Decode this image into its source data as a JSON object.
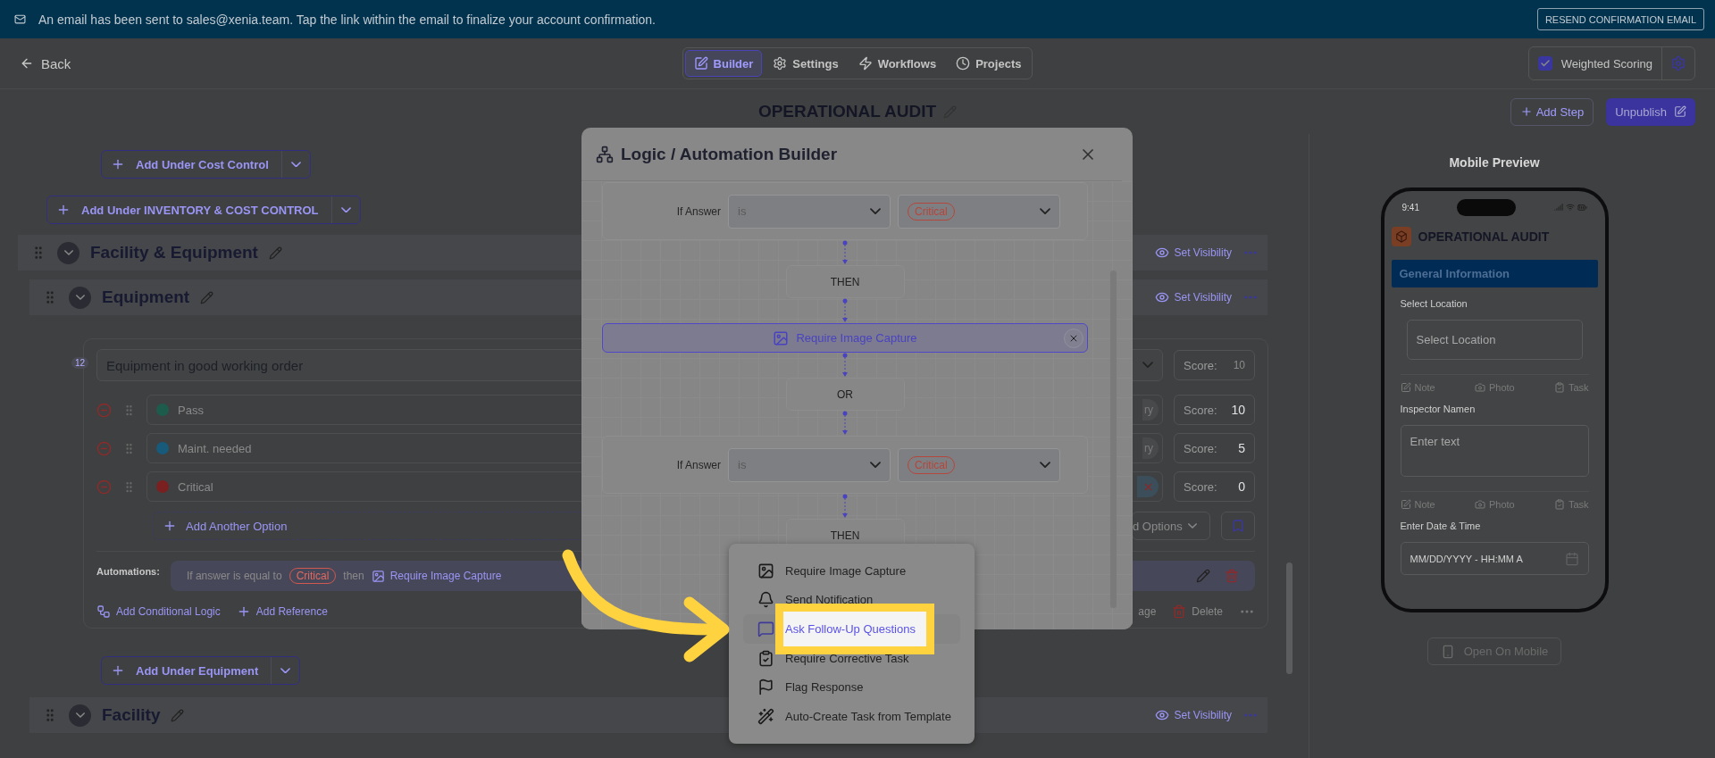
{
  "banner": {
    "message": "An email has been sent to sales@xenia.team. Tap the link within the email to finalize your account confirmation.",
    "button": "RESEND CONFIRMATION EMAIL"
  },
  "nav": {
    "back": "Back",
    "tabs": [
      {
        "label": "Builder",
        "selected": true
      },
      {
        "label": "Settings",
        "selected": false
      },
      {
        "label": "Workflows",
        "selected": false
      },
      {
        "label": "Projects",
        "selected": false
      }
    ],
    "weighted_scoring": {
      "label": "Weighted Scoring",
      "checked": true
    }
  },
  "header": {
    "title": "OPERATIONAL AUDIT",
    "add_step": "Add Step",
    "unpublish": "Unpublish"
  },
  "builder": {
    "add_cost_control": "Add Under Cost Control",
    "add_inventory": "Add Under INVENTORY & COST CONTROL",
    "section": {
      "title": "Facility & Equipment",
      "visibility": "Set Visibility"
    },
    "subsection": {
      "title": "Equipment",
      "visibility": "Set Visibility"
    },
    "question": {
      "number": "12",
      "text": "Equipment in good working order",
      "score_label": "Score:",
      "score_placeholder": "10",
      "options": [
        {
          "label": "Pass",
          "color": "#1d5c4c",
          "chip": {
            "kind": "text",
            "label": "ry"
          },
          "score_label": "Score:",
          "score": "10"
        },
        {
          "label": "Maint. needed",
          "color": "#175a7a",
          "chip": {
            "kind": "text",
            "label": "ry"
          },
          "score_label": "Score:",
          "score": "5"
        },
        {
          "label": "Critical",
          "color": "#7a2020",
          "chip": {
            "kind": "remove"
          },
          "score_label": "Score:",
          "score": "0"
        }
      ],
      "add_option": "Add Another Option",
      "options_select": "d Options",
      "automations": {
        "label": "Automations:",
        "prefix": "If answer is equal to",
        "answer": "Critical",
        "then": "then",
        "action": "Require Image Capture"
      },
      "footer": {
        "conditional": "Add Conditional Logic",
        "reference": "Add Reference",
        "image": "age",
        "delete": "Delete"
      }
    },
    "add_equipment": "Add Under Equipment",
    "facility": {
      "title": "Facility",
      "visibility": "Set Visibility"
    }
  },
  "preview": {
    "title": "Mobile Preview",
    "time": "9:41",
    "app_title": "OPERATIONAL AUDIT",
    "section": "General Information",
    "fields": [
      {
        "kind": "select",
        "label": "Select Location",
        "placeholder": "Select Location",
        "actions": [
          "Note",
          "Photo",
          "Task"
        ]
      },
      {
        "kind": "textarea",
        "label": "Inspector Namen",
        "placeholder": "Enter text",
        "actions": [
          "Note",
          "Photo",
          "Task"
        ]
      },
      {
        "kind": "datetime",
        "label": "Enter Date & Time",
        "placeholder": "MM/DD/YYYY - HH:MM A"
      }
    ],
    "open_mobile": "Open On Mobile"
  },
  "modal": {
    "title": "Logic / Automation Builder",
    "flow": [
      {
        "kind": "condition",
        "label": "If Answer",
        "operator": "is",
        "answer": "Critical"
      },
      {
        "kind": "connector",
        "label": "THEN"
      },
      {
        "kind": "action",
        "label": "Require Image Capture"
      },
      {
        "kind": "connector",
        "label": "OR"
      },
      {
        "kind": "condition",
        "label": "If Answer",
        "operator": "is",
        "answer": "Critical"
      },
      {
        "kind": "connector",
        "label": "THEN"
      }
    ]
  },
  "menu": [
    {
      "label": "Require Image Capture",
      "selected": false
    },
    {
      "label": "Send Notification",
      "selected": false
    },
    {
      "label": "Ask Follow-Up Questions",
      "selected": true
    },
    {
      "label": "Require Corrective Task",
      "selected": false
    },
    {
      "label": "Flag Response",
      "selected": false
    },
    {
      "label": "Auto-Create Task from Template",
      "selected": false
    }
  ]
}
